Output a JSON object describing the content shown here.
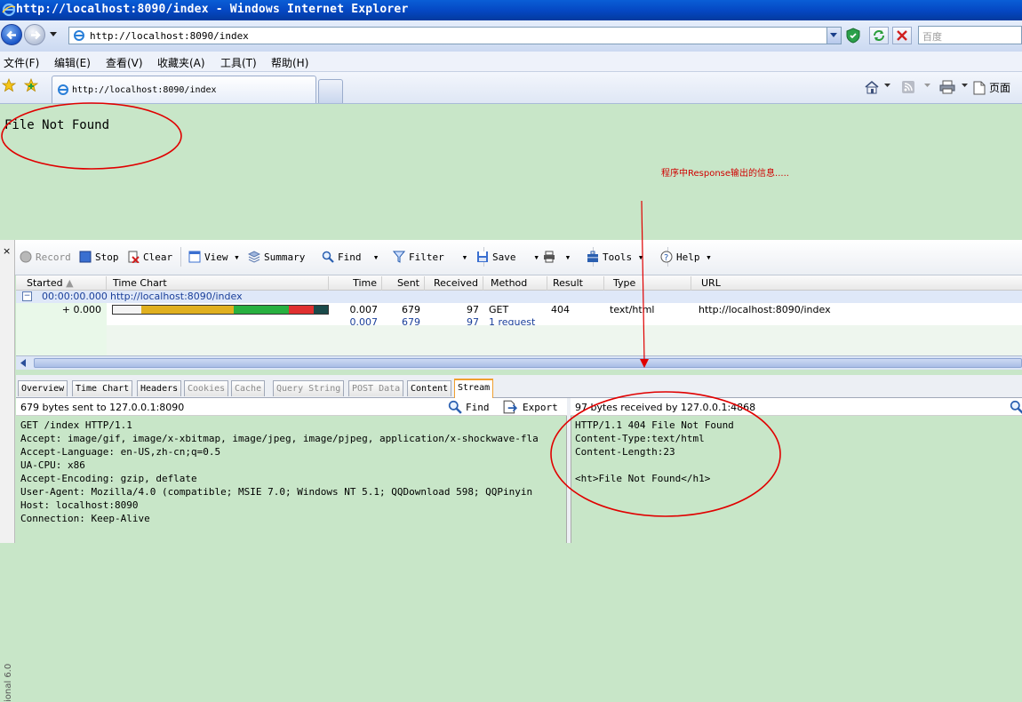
{
  "window": {
    "title": "http://localhost:8090/index - Windows Internet Explorer"
  },
  "address": {
    "url": "http://localhost:8090/index",
    "search_placeholder": "百度"
  },
  "menu": [
    "文件(F)",
    "编辑(E)",
    "查看(V)",
    "收藏夹(A)",
    "工具(T)",
    "帮助(H)"
  ],
  "tab": {
    "label": "http://localhost:8090/index",
    "page_button": "页面"
  },
  "page": {
    "message": "File Not Found"
  },
  "annotation": {
    "text": "程序中Response输出的信息....."
  },
  "fiddler": {
    "toolbar": {
      "record": "Record",
      "stop": "Stop",
      "clear": "Clear",
      "view": "View",
      "summary": "Summary",
      "find": "Find",
      "filter": "Filter",
      "save": "Save",
      "tools": "Tools",
      "help": "Help"
    },
    "columns": {
      "started": "Started",
      "time_chart": "Time Chart",
      "time": "Time",
      "sent": "Sent",
      "received": "Received",
      "method": "Method",
      "result": "Result",
      "type": "Type",
      "url": "URL"
    },
    "group": {
      "started": "00:00:00.000",
      "url": "http://localhost:8090/index"
    },
    "row": {
      "started": "+ 0.000",
      "time": "0.007",
      "sent": "679",
      "received": "97",
      "method": "GET",
      "result": "404",
      "type": "text/html",
      "url": "http://localhost:8090/index"
    },
    "summary_row": {
      "time": "0.007",
      "sent": "679",
      "received": "97",
      "requests": "1 request"
    },
    "inspector_tabs": [
      "Overview",
      "Time Chart",
      "Headers",
      "Cookies",
      "Cache",
      "Query String",
      "POST Data",
      "Content",
      "Stream"
    ],
    "active_tab": "Stream",
    "request_panel": {
      "header": "679 bytes sent to 127.0.0.1:8090",
      "find": "Find",
      "export": "Export",
      "lines": [
        "GET /index HTTP/1.1",
        "Accept: image/gif, image/x-xbitmap, image/jpeg, image/pjpeg, application/x-shockwave-fla",
        "Accept-Language: en-US,zh-cn;q=0.5",
        "UA-CPU: x86",
        "Accept-Encoding: gzip, deflate",
        "User-Agent: Mozilla/4.0 (compatible; MSIE 7.0; Windows NT 5.1; QQDownload 598; QQPinyin",
        "Host: localhost:8090",
        "Connection: Keep-Alive"
      ]
    },
    "response_panel": {
      "header": "97 bytes received by 127.0.0.1:4868",
      "lines": [
        "HTTP/1.1 404 File Not Found",
        "Content-Type:text/html",
        "Content-Length:23",
        "",
        "<ht>File Not Found</h1>"
      ]
    },
    "side_label": "ional 6.0",
    "close_glyph": "×"
  }
}
